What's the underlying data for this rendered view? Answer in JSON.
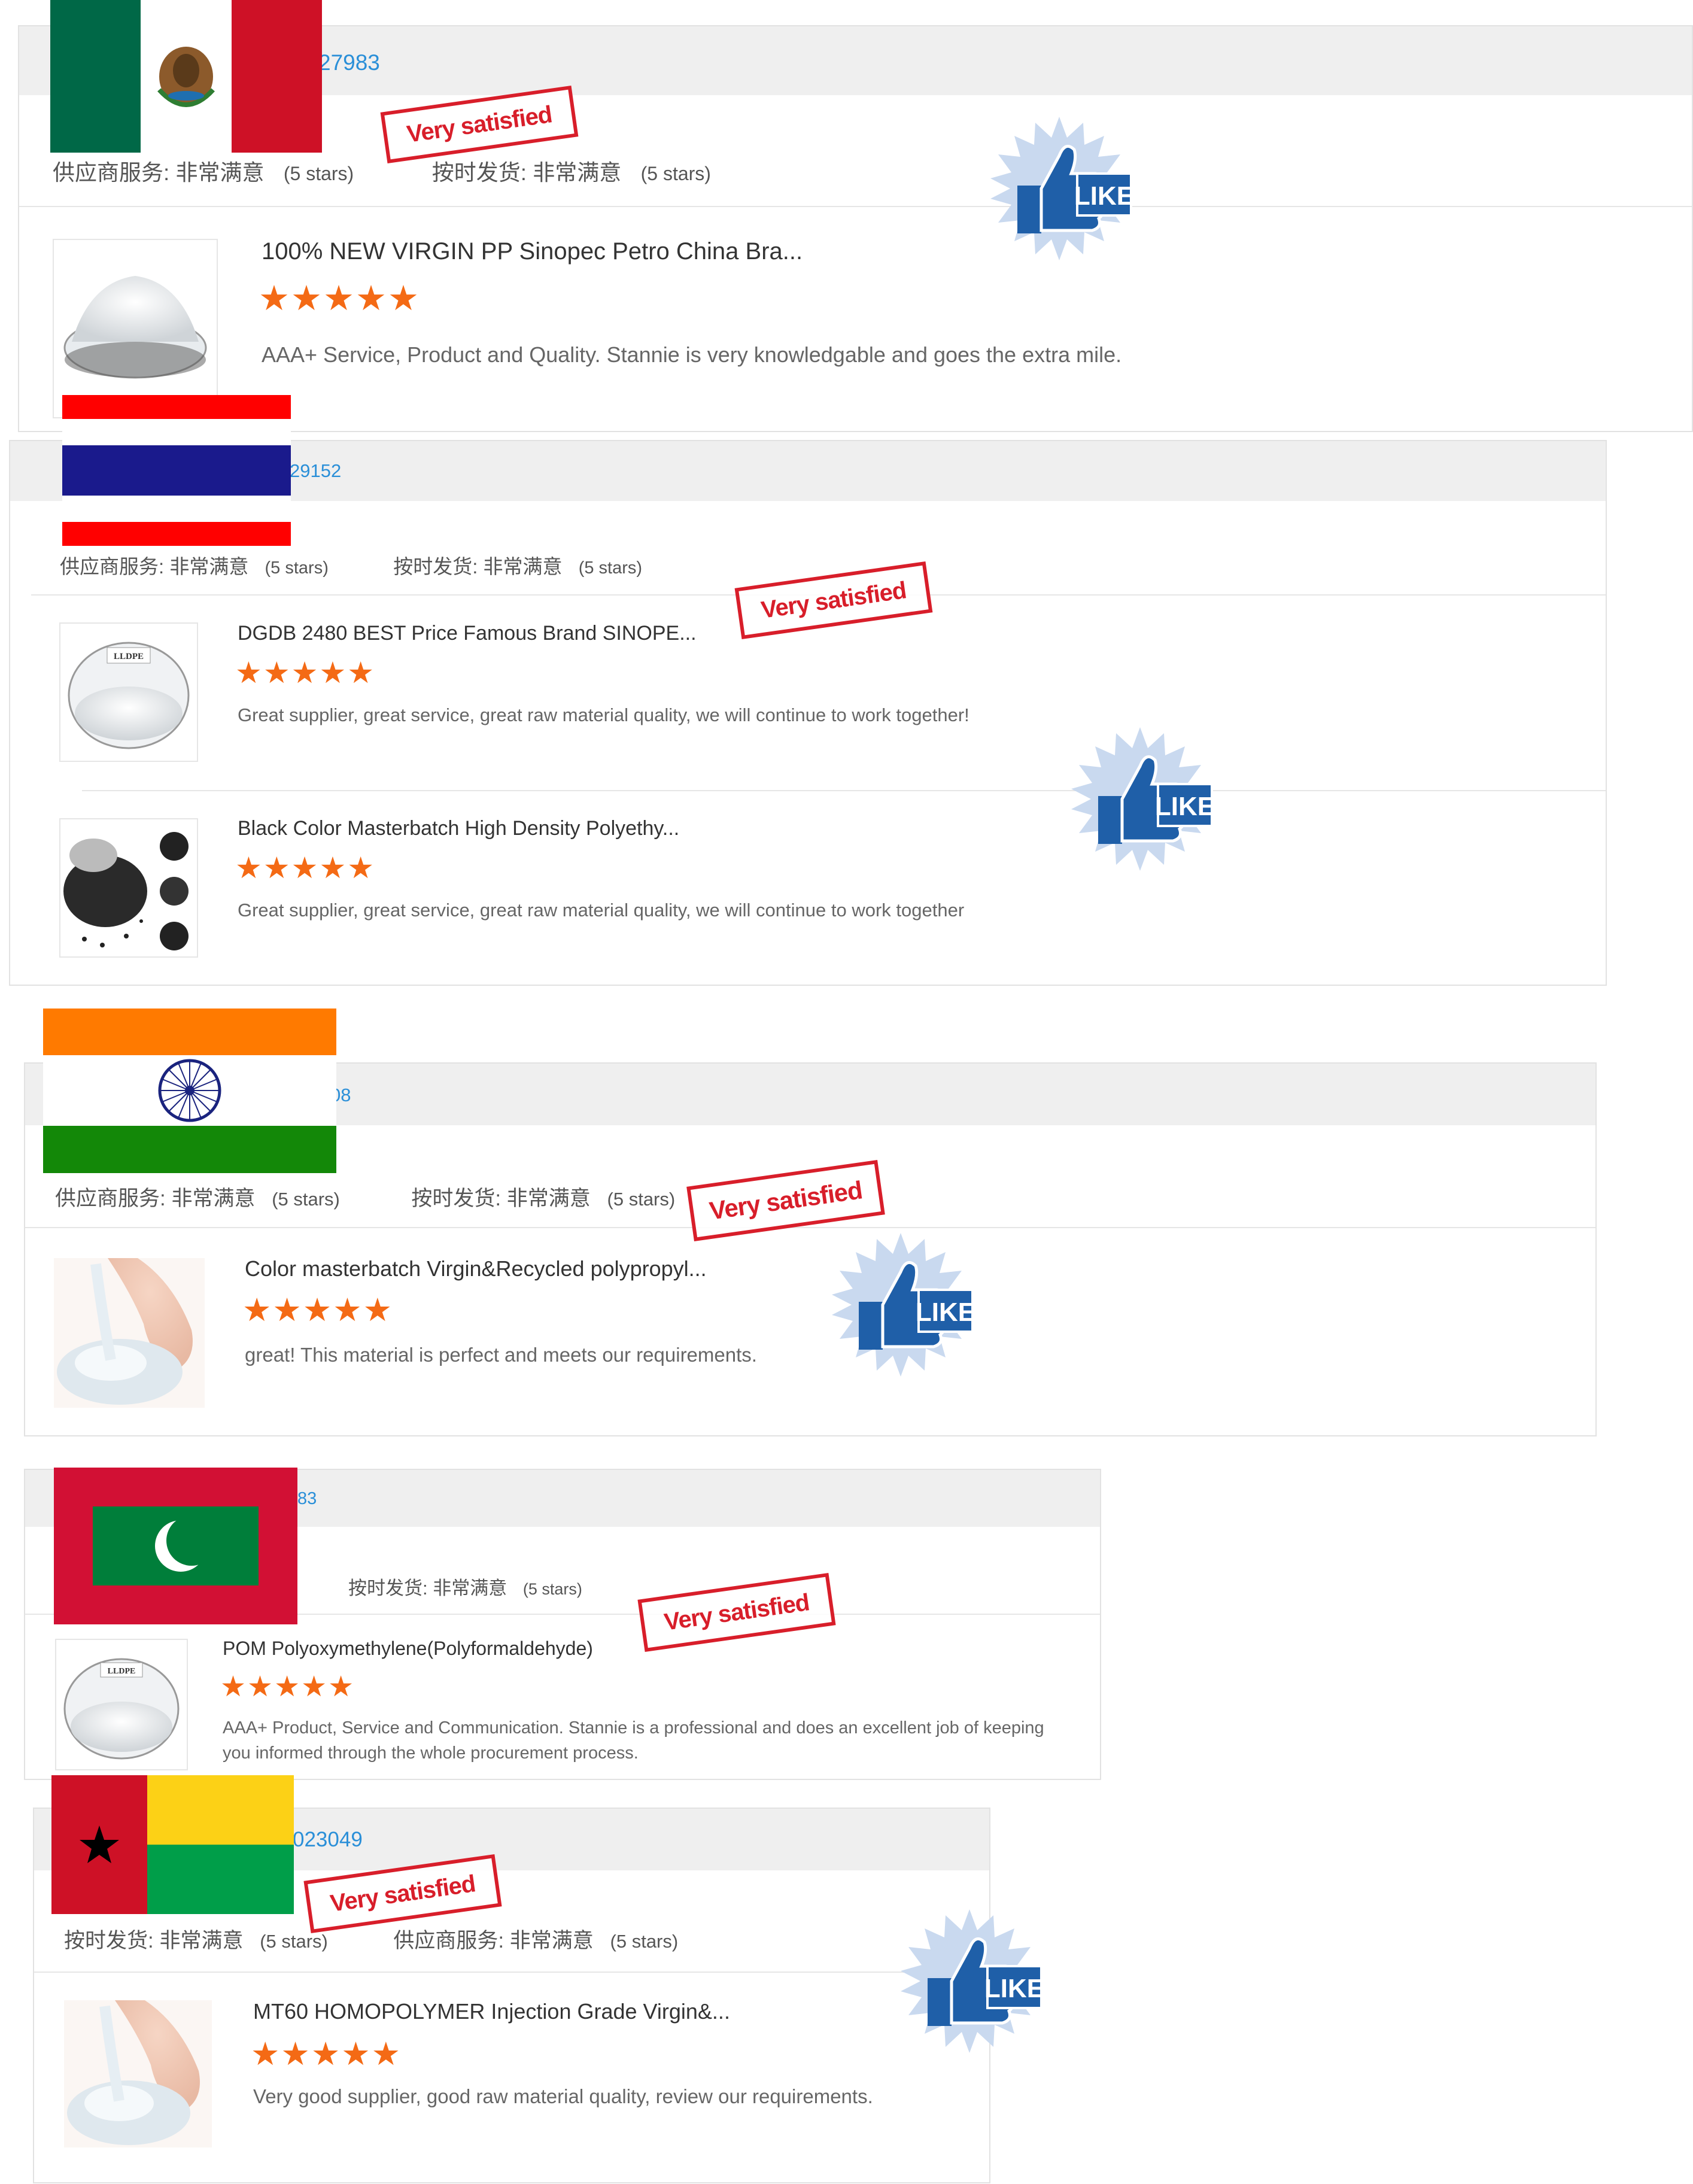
{
  "colors": {
    "accent": "#2a8fd8",
    "star": "#f46a15",
    "stamp": "#d81e2a",
    "like_blue": "#1f5fa8"
  },
  "stamp_text": "Very satisfied",
  "like_text": "LIKE",
  "reviews": [
    {
      "flag": "mexico",
      "order_id": "27983",
      "ratings": [
        {
          "label": "供应商服务: 非常满意",
          "note": "(5 stars)"
        },
        {
          "label": "按时发货: 非常满意",
          "note": "(5 stars)"
        }
      ],
      "items": [
        {
          "image": "white-pellets-icon",
          "title": "100% NEW VIRGIN PP Sinopec Petro China Bra...",
          "stars": "★★★★★",
          "text": "AAA+ Service, Product and Quality. Stannie is very knowledgable and goes the extra mile."
        }
      ]
    },
    {
      "flag": "thailand",
      "order_id": "29152",
      "ratings": [
        {
          "label": "供应商服务: 非常满意",
          "note": "(5 stars)"
        },
        {
          "label": "按时发货: 非常满意",
          "note": "(5 stars)"
        }
      ],
      "items": [
        {
          "image": "lldpe-pellets-icon",
          "image_label": "LLDPE",
          "title": "DGDB 2480 BEST Price Famous Brand SINOPE...",
          "stars": "★★★★★",
          "text": "Great supplier, great service, great raw material quality, we will continue to work together!"
        },
        {
          "image": "black-pellets-icon",
          "title": "Black Color Masterbatch High Density Polyethy...",
          "stars": "★★★★★",
          "text": "Great supplier, great service, great raw material quality, we will continue to work together"
        }
      ]
    },
    {
      "flag": "india",
      "order_id": "08",
      "ratings": [
        {
          "label": "供应商服务: 非常满意",
          "note": "(5 stars)"
        },
        {
          "label": "按时发货: 非常满意",
          "note": "(5 stars)"
        }
      ],
      "items": [
        {
          "image": "hand-pellets-icon",
          "title": "Color masterbatch Virgin&Recycled polypropyl...",
          "stars": "★★★★★",
          "text": "great!  This material is perfect and meets our requirements."
        }
      ]
    },
    {
      "flag": "maldives",
      "order_id": "83",
      "ratings": [
        {
          "label": "按时发货: 非常满意",
          "note": "(5 stars)"
        }
      ],
      "items": [
        {
          "image": "lldpe-pellets-icon",
          "image_label": "LLDPE",
          "title": "POM Polyoxymethylene(Polyformaldehyde)",
          "stars": "★★★★★",
          "text": "AAA+ Product, Service and Communication. Stannie is a professional and does an excellent job of keeping you informed through the whole procurement process."
        }
      ]
    },
    {
      "flag": "guinea-bissau",
      "order_id": "023049",
      "ratings": [
        {
          "label": "按时发货: 非常满意",
          "note": "(5 stars)"
        },
        {
          "label": "供应商服务: 非常满意",
          "note": "(5 stars)"
        }
      ],
      "items": [
        {
          "image": "hand-pellets-icon",
          "title": "MT60 HOMOPOLYMER Injection Grade Virgin&...",
          "stars": "★★★★★",
          "text": "Very good supplier, good raw material quality, review our requirements."
        }
      ]
    }
  ]
}
